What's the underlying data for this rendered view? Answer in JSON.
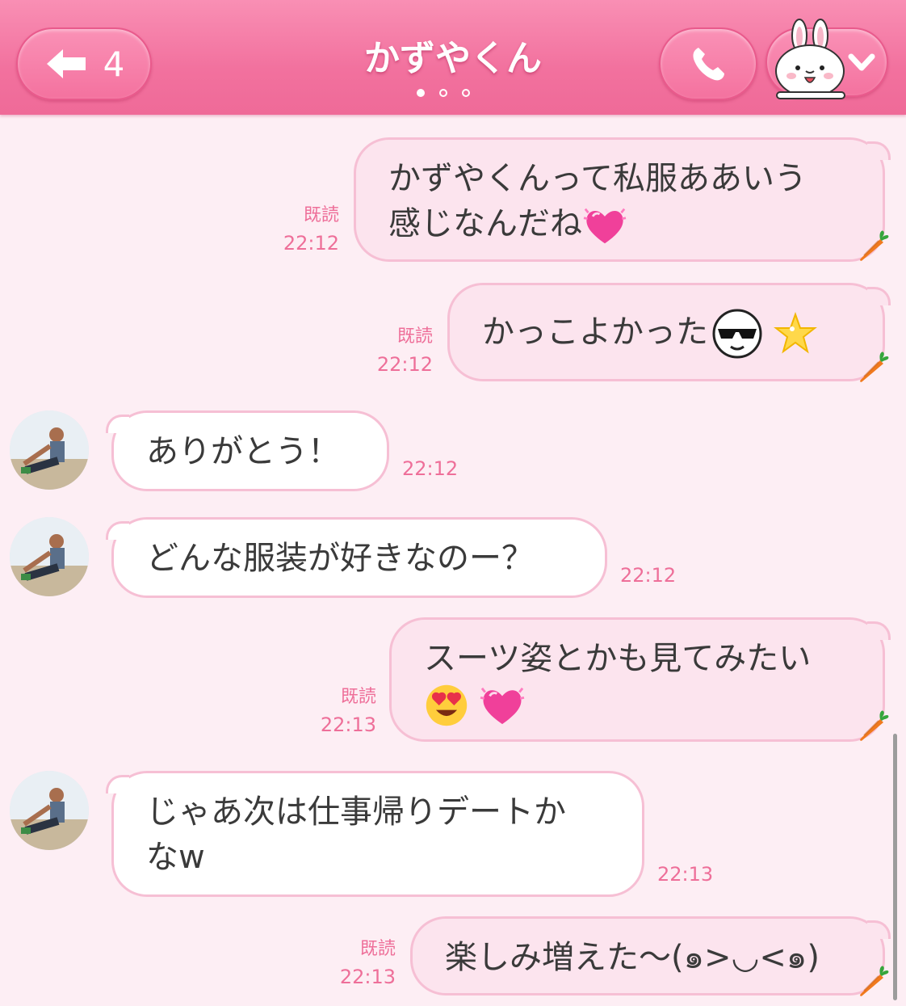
{
  "header": {
    "title": "かずやくん",
    "back_count": "4",
    "page_dots": 3,
    "active_dot": 0,
    "back_icon": "back-arrow-icon",
    "call_icon": "phone-icon",
    "menu_icon": "chevron-down-icon"
  },
  "colors": {
    "header": "#f2719e",
    "background": "#fdeef4",
    "outgoing_bubble": "#fce4ee",
    "incoming_bubble": "#ffffff",
    "meta_text": "#ee6f99"
  },
  "messages": [
    {
      "side": "out",
      "line1": "かずやくんって私服ああいう",
      "line2": "感じなんだね",
      "read": "既読",
      "time": "22:12"
    },
    {
      "side": "out",
      "text": "かっこよかった",
      "read": "既読",
      "time": "22:12"
    },
    {
      "side": "in",
      "text": "ありがとう！",
      "time": "22:12"
    },
    {
      "side": "in",
      "text": "どんな服装が好きなのー？",
      "time": "22:12"
    },
    {
      "side": "out",
      "line1": "スーツ姿とかも見てみたい",
      "read": "既読",
      "time": "22:13"
    },
    {
      "side": "in",
      "line1": "じゃあ次は仕事帰りデートか",
      "line2": "なw",
      "time": "22:13"
    },
    {
      "side": "out",
      "text": "楽しみ増えた〜(๑>◡<๑)",
      "read": "既読",
      "time": "22:13"
    }
  ]
}
